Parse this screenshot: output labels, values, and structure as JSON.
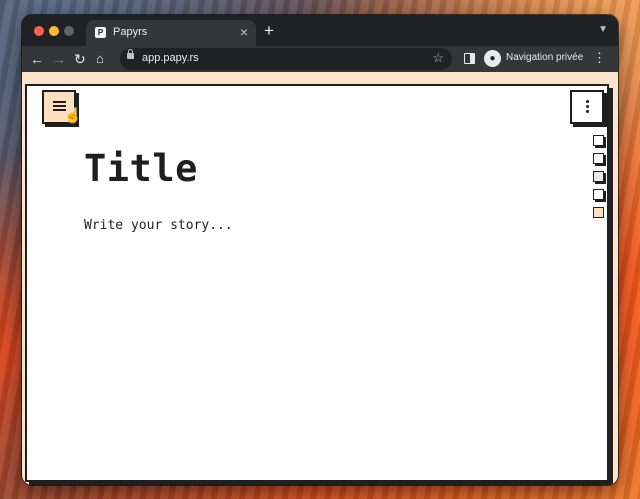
{
  "browser": {
    "tab": {
      "title": "Papyrs",
      "favicon": "papyrs-favicon"
    },
    "url": "app.papy.rs",
    "profile_label": "Navigation privée",
    "traffic_lights": [
      "#ff5f57",
      "#febc2e",
      "#5f6368"
    ]
  },
  "editor": {
    "title": "Title",
    "placeholder": "Write your story...",
    "outline_count": 5
  },
  "colors": {
    "accent": "#fde0c1",
    "ink": "#1f1f1f",
    "chrome_dark": "#202124"
  }
}
